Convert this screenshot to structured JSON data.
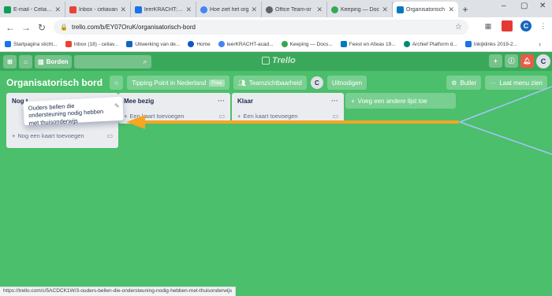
{
  "browser": {
    "tabs": [
      {
        "title": "E-mail - Celia van",
        "color": "#0f9d58"
      },
      {
        "title": "Inbox - celiavan",
        "color": "#ea4335"
      },
      {
        "title": "leerKRACHT: van",
        "color": "#1a73e8"
      },
      {
        "title": "Hoe ziet het org",
        "color": "#4285f4"
      },
      {
        "title": "Office Team-or",
        "color": "#5f6368"
      },
      {
        "title": "Keeping — Doc",
        "color": "#34a853"
      },
      {
        "title": "Organisatorisch",
        "color": "#0079bf",
        "active": true
      }
    ],
    "url": "trello.com/b/EY07OruK/organisatorisch-bord",
    "profile_initial": "C",
    "bookmarks": [
      {
        "label": "Startpagina sticht...",
        "color": "#1a73e8"
      },
      {
        "label": "Inbox (18) - celiav...",
        "color": "#ea4335"
      },
      {
        "label": "Uitwerking van de...",
        "color": "#1565c0"
      },
      {
        "label": "Home",
        "color": "#0b57d0"
      },
      {
        "label": "leerKRACHT-acad...",
        "color": "#4285f4"
      },
      {
        "label": "Keeping — Docs...",
        "color": "#34a853"
      },
      {
        "label": "Feest en Afwas 19...",
        "color": "#0079bf"
      },
      {
        "label": "Archief Platform d...",
        "color": "#00897b"
      },
      {
        "label": "Inkijklinks 2019-2...",
        "color": "#1a73e8"
      }
    ],
    "status_url": "https://trello.com/c/5ACDCK1W/3-ouders-bellen-die-ondersteuning-nodig-hebben-met-thuisonderwijs"
  },
  "trello": {
    "boards_label": "Borden",
    "logo_text": "Trello",
    "avatar_initial": "C",
    "board": {
      "title": "Organisatorisch bord",
      "team_name": "Tipping Point in Nederland",
      "team_badge": "Free",
      "visibility": "Teamzichtbaarheid",
      "member_initial": "C",
      "invite_label": "Uitnodigen",
      "butler_label": "Butler",
      "show_menu_label": "Laat menu zien"
    },
    "lists": [
      {
        "title": "Nog t",
        "add_label": "Nog een kaart toevoegen"
      },
      {
        "title": "Mee bezig",
        "add_label": "Een kaart toevoegen"
      },
      {
        "title": "Klaar",
        "add_label": "Een kaart toevoegen"
      }
    ],
    "add_list_label": "Voeg een andere lijst toe",
    "dragged_card_text": "Ouders bellen die ondersteuning nodig hebben met thuisonderwijs"
  },
  "colors": {
    "board_bg": "#4bbf6b",
    "header_bg": "#3aa85a",
    "annotation_arrow": "#f5a623",
    "annotation_line": "#a7c4ff"
  }
}
